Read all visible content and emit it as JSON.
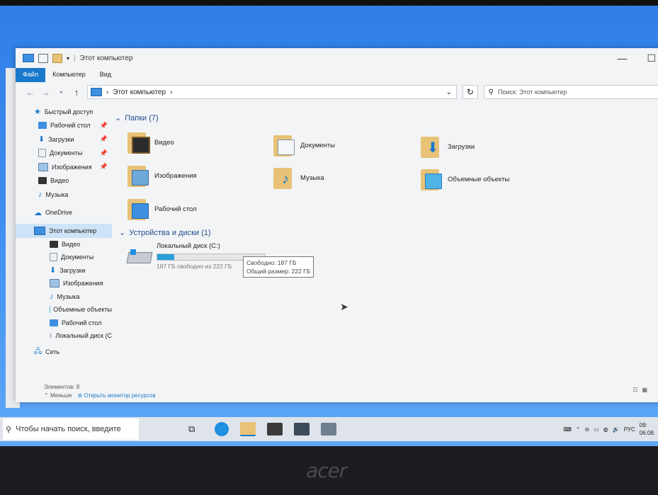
{
  "window": {
    "title": "Этот компьютер",
    "controls": {
      "minimize": "—",
      "maximize": "☐"
    }
  },
  "ribbon": {
    "tabs": [
      "Файл",
      "Компьютер",
      "Вид"
    ],
    "active": "Файл"
  },
  "addressbar": {
    "path": "Этот компьютер",
    "search_placeholder": "Поиск: Этот компьютер"
  },
  "sidebar": {
    "quick_access": "Быстрый доступ",
    "quick_items": [
      {
        "label": "Рабочий стол",
        "icon": "desktop-icon",
        "pinned": true
      },
      {
        "label": "Загрузки",
        "icon": "downloads-icon",
        "pinned": true
      },
      {
        "label": "Документы",
        "icon": "documents-icon",
        "pinned": true
      },
      {
        "label": "Изображения",
        "icon": "pictures-icon",
        "pinned": true
      },
      {
        "label": "Видео",
        "icon": "video-icon",
        "pinned": false
      },
      {
        "label": "Музыка",
        "icon": "music-icon",
        "pinned": false
      }
    ],
    "onedrive": "OneDrive",
    "this_pc": "Этот компьютер",
    "pc_items": [
      "Видео",
      "Документы",
      "Загрузки",
      "Изображения",
      "Музыка",
      "Объемные объекты",
      "Рабочий стол",
      "Локальный диск (С"
    ],
    "network": "Сеть"
  },
  "folders": {
    "header": "Папки (7)",
    "items": [
      {
        "label": "Видео",
        "icon": "video-folder-icon"
      },
      {
        "label": "Документы",
        "icon": "documents-folder-icon"
      },
      {
        "label": "Загрузки",
        "icon": "downloads-folder-icon"
      },
      {
        "label": "Изображения",
        "icon": "pictures-folder-icon"
      },
      {
        "label": "Музыка",
        "icon": "music-folder-icon"
      },
      {
        "label": "Объемные объекты",
        "icon": "3d-objects-folder-icon"
      },
      {
        "label": "Рабочий стол",
        "icon": "desktop-folder-icon"
      }
    ]
  },
  "devices": {
    "header": "Устройства и диски (1)",
    "drive": {
      "label": "Локальный диск (C:)",
      "free_text": "187 ГБ свободно из 222 ГБ",
      "used_fraction": 0.16
    }
  },
  "tooltip": {
    "line1": "Свободно: 187 ГБ",
    "line2": "Общий размер: 222 ГБ"
  },
  "statusbar": {
    "items_count": "Элементов: 8",
    "less": "Меньше",
    "resource_monitor": "Открыть монитор ресурсов"
  },
  "taskbar": {
    "search_placeholder": "Чтобы начать поиск, введите",
    "language": "РУС",
    "time": "09:",
    "date": "06.08."
  },
  "colors": {
    "accent": "#1979ca",
    "drive_fill": "#26a0da",
    "folder": "#e8c277",
    "desktop": "#3a8af0"
  },
  "brand": "acer"
}
